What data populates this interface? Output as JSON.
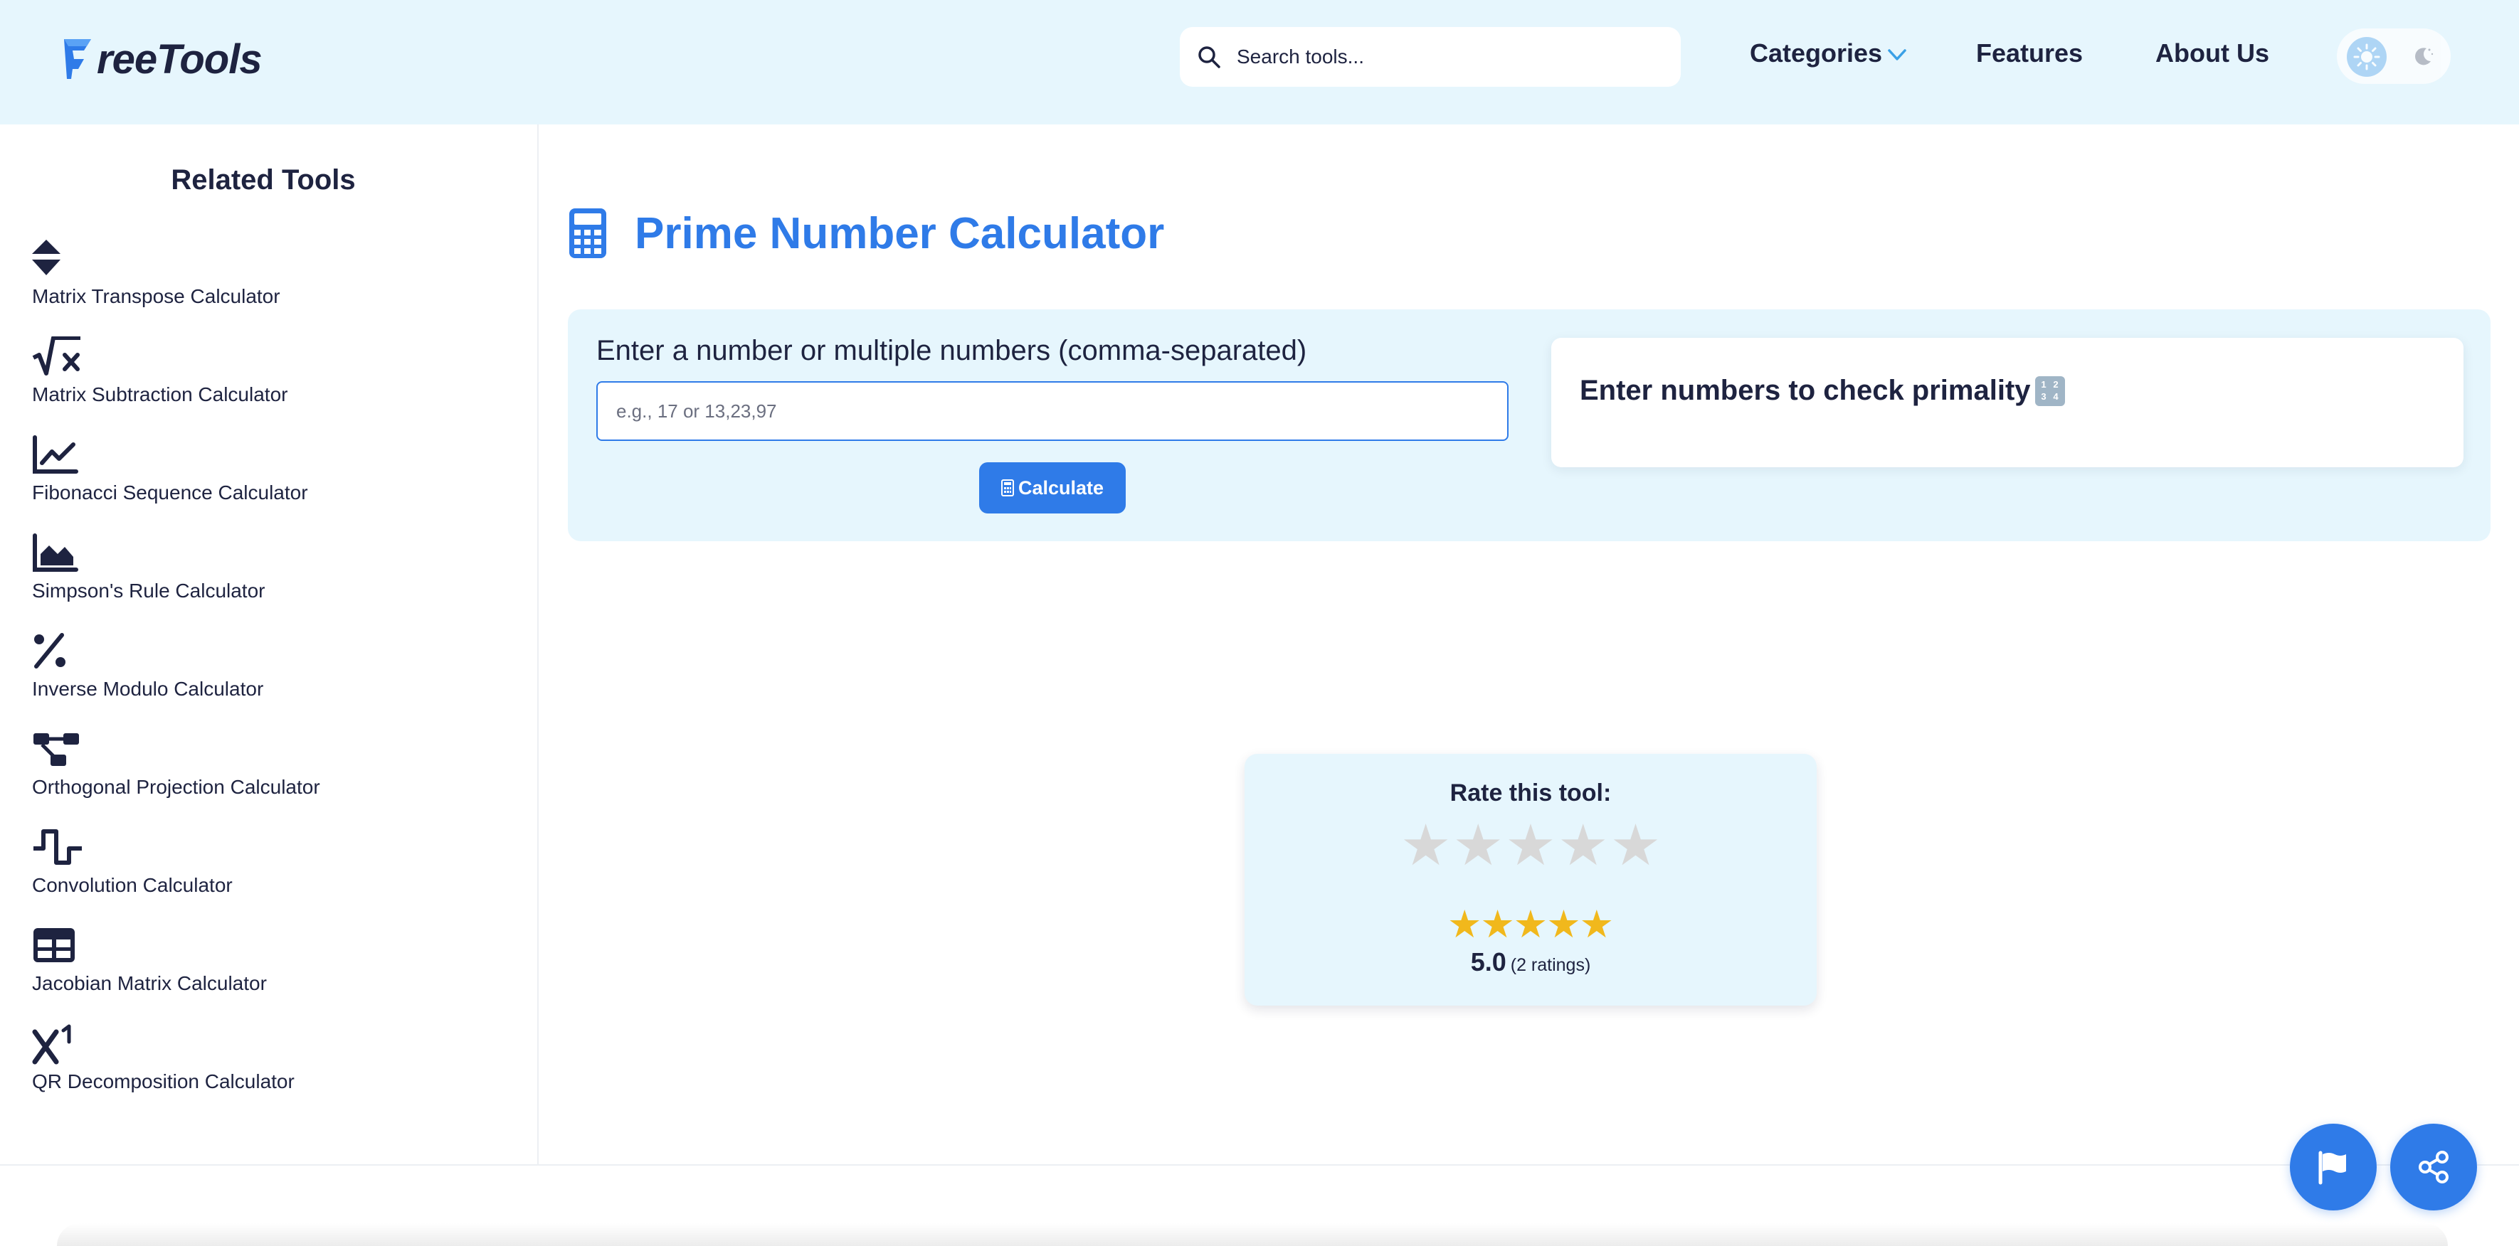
{
  "header": {
    "logo_text": "reeTools",
    "search_placeholder": "Search tools...",
    "nav": {
      "categories": "Categories",
      "features": "Features",
      "about": "About Us"
    }
  },
  "sidebar": {
    "title": "Related Tools",
    "items": [
      {
        "label": "Matrix Transpose Calculator",
        "icon": "sort-icon"
      },
      {
        "label": "Matrix Subtraction Calculator",
        "icon": "square-root-icon"
      },
      {
        "label": "Fibonacci Sequence Calculator",
        "icon": "line-chart-icon"
      },
      {
        "label": "Simpson's Rule Calculator",
        "icon": "area-chart-icon"
      },
      {
        "label": "Inverse Modulo Calculator",
        "icon": "percent-icon"
      },
      {
        "label": "Orthogonal Projection Calculator",
        "icon": "diagram-icon"
      },
      {
        "label": "Convolution Calculator",
        "icon": "wave-square-icon"
      },
      {
        "label": "Jacobian Matrix Calculator",
        "icon": "table-icon"
      },
      {
        "label": "QR Decomposition Calculator",
        "icon": "superscript-icon"
      }
    ]
  },
  "main": {
    "title": "Prime Number Calculator",
    "input_label": "Enter a number or multiple numbers (comma-separated)",
    "input_placeholder": "e.g., 17 or 13,23,97",
    "calculate_label": "Calculate",
    "result_text": "Enter numbers to check primality"
  },
  "rating": {
    "title": "Rate this tool:",
    "score": "5.0",
    "count": "(2 ratings)",
    "average": 5,
    "max": 5
  },
  "colors": {
    "accent": "#2f7be8",
    "panel_bg": "#e6f6fd",
    "text": "#1e2340",
    "star": "#f1b81c"
  }
}
